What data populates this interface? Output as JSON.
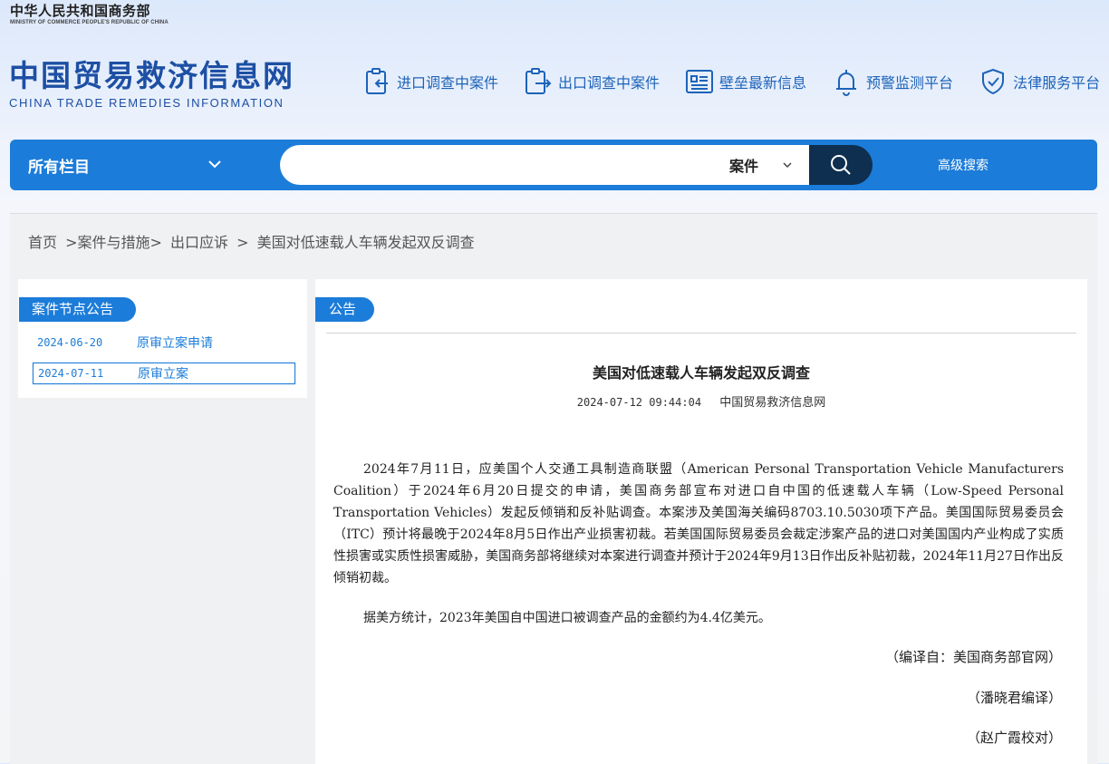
{
  "header": {
    "ministry_cn": "中华人民共和国商务部",
    "ministry_en": "MINISTRY OF COMMERCE PEOPLE'S REPUBLIC OF CHINA",
    "site_cn": "中国贸易救济信息网",
    "site_en": "CHINA TRADE REMEDIES INFORMATION"
  },
  "nav": {
    "items": [
      {
        "label": "进口调查中案件",
        "icon": "import-case-icon"
      },
      {
        "label": "出口调查中案件",
        "icon": "export-case-icon"
      },
      {
        "label": "壁垒最新信息",
        "icon": "barrier-info-icon"
      },
      {
        "label": "预警监测平台",
        "icon": "bell-icon"
      },
      {
        "label": "法律服务平台",
        "icon": "shield-check-icon"
      }
    ]
  },
  "search": {
    "category": "所有栏目",
    "type": "案件",
    "query": "",
    "advanced_label": "高级搜索"
  },
  "breadcrumb": [
    "首页",
    ">案件与措施>",
    "出口应诉",
    ">",
    "美国对低速载人车辆发起双反调查"
  ],
  "left_panel": {
    "title": "案件节点公告",
    "nodes": [
      {
        "date": "2024-06-20",
        "label": "原审立案申请"
      },
      {
        "date": "2024-07-11",
        "label": "原审立案"
      }
    ]
  },
  "article": {
    "tab_label": "公告",
    "title": "美国对低速载人车辆发起双反调查",
    "datetime": "2024-07-12 09:44:04",
    "source": "中国贸易救济信息网",
    "paragraphs": [
      "2024年7月11日，应美国个人交通工具制造商联盟（American Personal Transportation Vehicle Manufacturers Coalition）于2024年6月20日提交的申请，美国商务部宣布对进口自中国的低速载人车辆（Low-Speed Personal Transportation Vehicles）发起反倾销和反补贴调查。本案涉及美国海关编码8703.10.5030项下产品。美国国际贸易委员会（ITC）预计将最晚于2024年8月5日作出产业损害初裁。若美国国际贸易委员会裁定涉案产品的进口对美国国内产业构成了实质性损害或实质性损害威胁，美国商务部将继续对本案进行调查并预计于2024年9月13日作出反补贴初裁，2024年11月27日作出反倾销初裁。",
      "据美方统计，2023年美国自中国进口被调查产品的金额约为4.4亿美元。"
    ],
    "credits": [
      "（编译自：美国商务部官网）",
      "（潘晓君编译）",
      "（赵广霞校对）"
    ]
  },
  "colors": {
    "accent": "#1c7cd9",
    "brand_text": "#1d4fa4",
    "search_button": "#0e2f4f"
  }
}
